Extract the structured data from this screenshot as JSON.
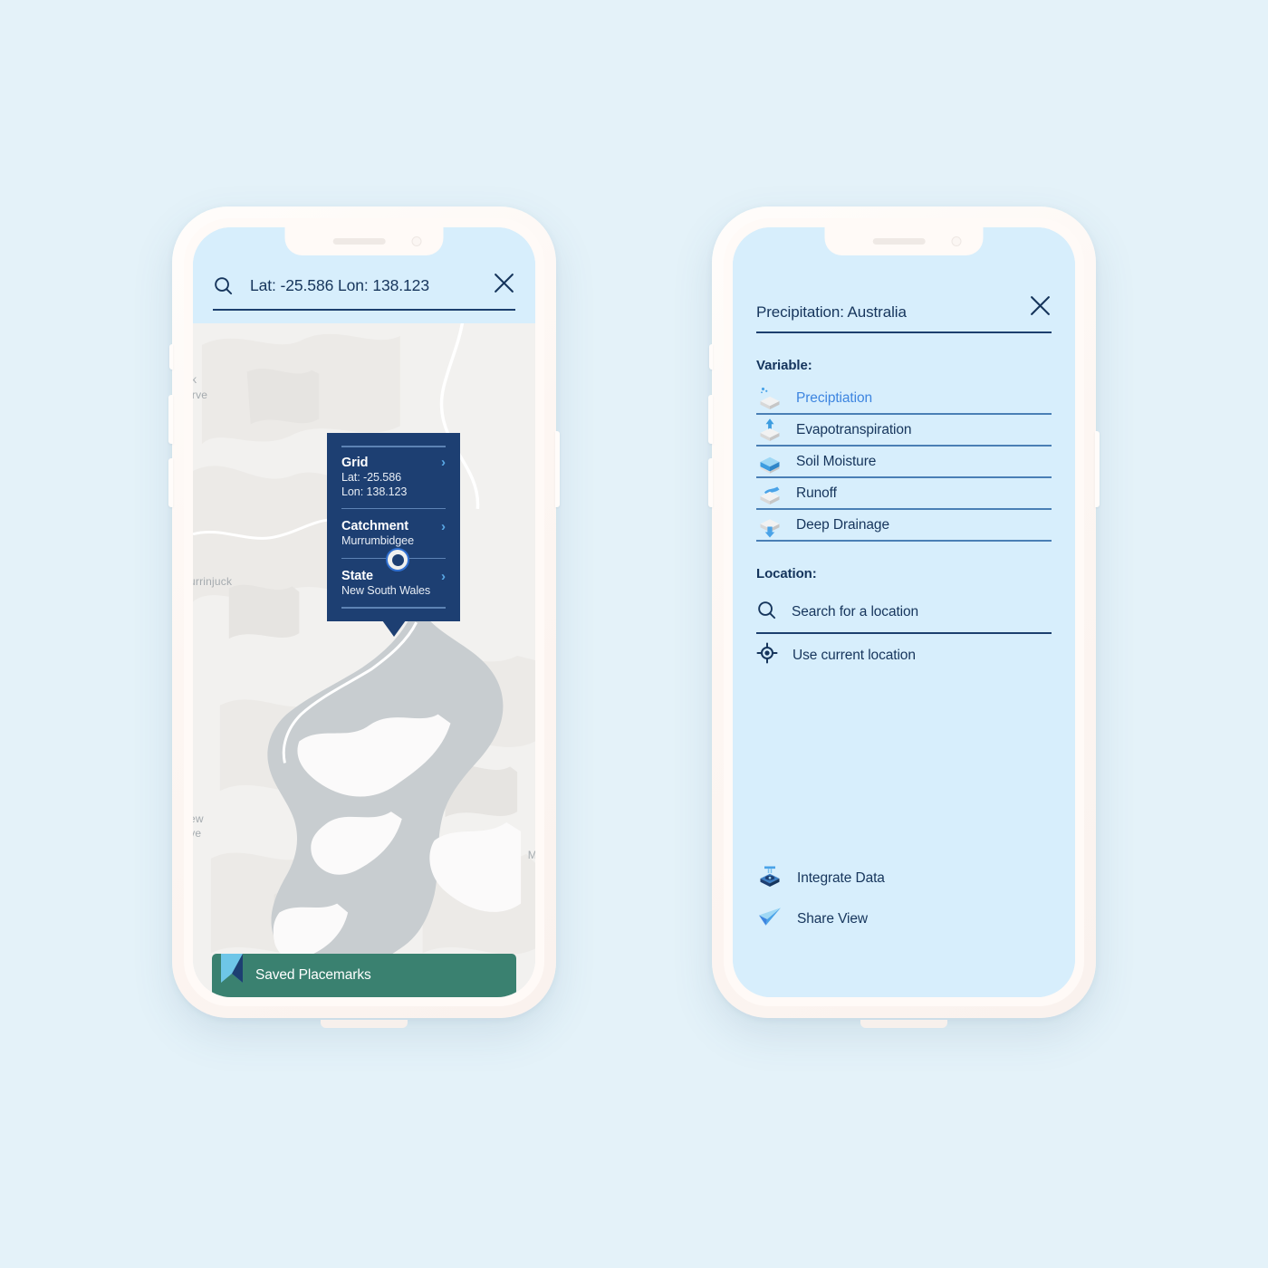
{
  "theme": {
    "page_background": "#e4f2f9",
    "screen_background": "#d7eefc",
    "accent_navy": "#1d3f72",
    "accent_blue": "#3d85e0",
    "separator_blue": "#4a7fb5",
    "green_bar": "#3a8170",
    "map_base": "#f2f1ef",
    "lake_gray": "#c8cdd0"
  },
  "map_screen": {
    "search": {
      "icon": "search-icon",
      "value": "Lat: -25.586 Lon: 138.123",
      "close_icon": "close-icon"
    },
    "info_card": {
      "sections": [
        {
          "title": "Grid",
          "value_line1": "Lat: -25.586",
          "value_line2": "Lon: 138.123",
          "chevron": "chevron-right-icon"
        },
        {
          "title": "Catchment",
          "value_line1": "Murrumbidgee",
          "value_line2": "",
          "chevron": "chevron-right-icon"
        },
        {
          "title": "State",
          "value_line1": "New South Wales",
          "value_line2": "",
          "chevron": "chevron-right-icon"
        }
      ]
    },
    "map_labels": [
      {
        "text": "Lake Burrinjuck",
        "style": "italic"
      },
      {
        "text": "urrinjuck",
        "style": "plain"
      },
      {
        "text": "k",
        "style": "plain"
      },
      {
        "text": "erve",
        "style": "plain"
      },
      {
        "text": "ew",
        "style": "plain"
      },
      {
        "text": "rve",
        "style": "plain"
      },
      {
        "text": "M",
        "style": "plain"
      }
    ],
    "marker": {
      "icon": "map-marker-dot"
    },
    "bottom_bar": {
      "icon": "bookmark-ribbon-icon",
      "label": "Saved Placemarks"
    }
  },
  "panel_screen": {
    "header": {
      "title": "Precipitation: Australia",
      "close_icon": "close-icon"
    },
    "variable_section_label": "Variable:",
    "variables": [
      {
        "label": "Preciptiation",
        "icon": "precipitation-cube-icon",
        "selected": true
      },
      {
        "label": "Evapotranspiration",
        "icon": "evapotranspiration-cube-icon",
        "selected": false
      },
      {
        "label": "Soil Moisture",
        "icon": "soil-moisture-cube-icon",
        "selected": false
      },
      {
        "label": "Runoff",
        "icon": "runoff-cube-icon",
        "selected": false
      },
      {
        "label": "Deep Drainage",
        "icon": "deep-drainage-cube-icon",
        "selected": false
      }
    ],
    "location_section_label": "Location:",
    "location_options": [
      {
        "label": "Search for a location",
        "icon": "search-icon"
      },
      {
        "label": "Use current location",
        "icon": "crosshair-location-icon"
      }
    ],
    "actions": [
      {
        "label": "Integrate Data",
        "icon": "integrate-data-icon"
      },
      {
        "label": "Share View",
        "icon": "paper-plane-icon"
      }
    ]
  }
}
